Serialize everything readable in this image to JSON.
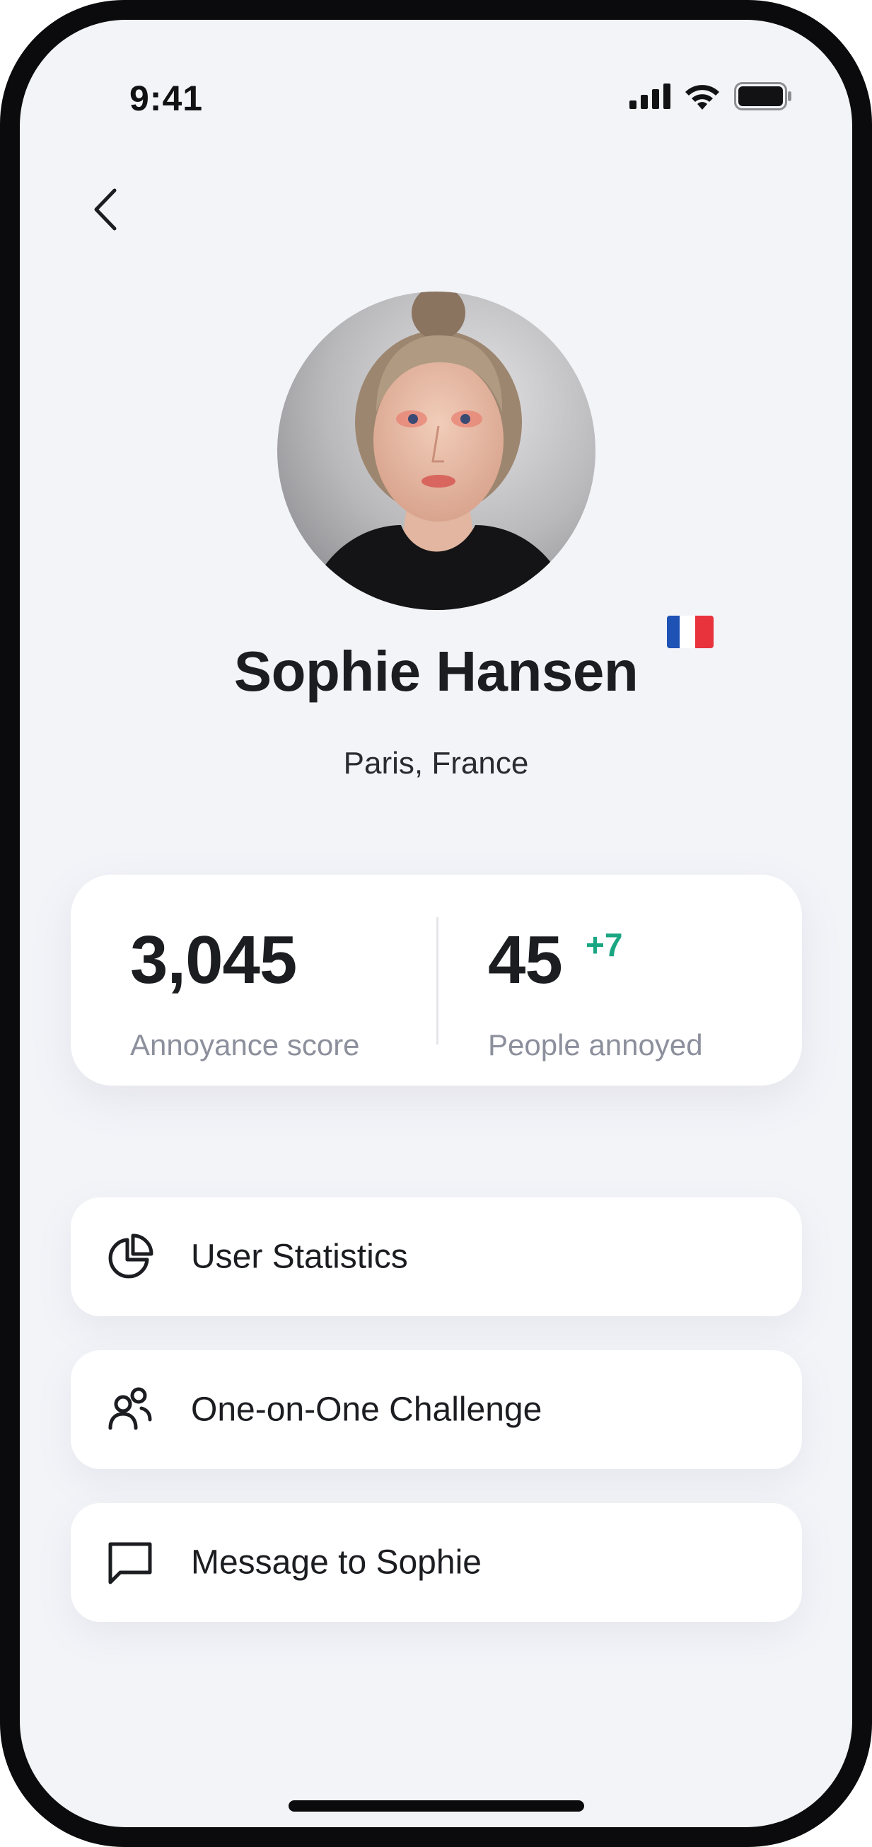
{
  "status_bar": {
    "time": "9:41",
    "signal_icon": "cellular-signal-icon",
    "wifi_icon": "wifi-icon",
    "battery_icon": "battery-icon"
  },
  "nav": {
    "back_icon": "chevron-left-icon"
  },
  "profile": {
    "name": "Sophie Hansen",
    "location": "Paris, France",
    "flag": "french-flag-icon"
  },
  "stats": {
    "annoyance_score": {
      "value": "3,045",
      "label": "Annoyance score"
    },
    "people_annoyed": {
      "value": "45",
      "delta": "+7",
      "label": "People annoyed"
    }
  },
  "actions": [
    {
      "label": "User Statistics",
      "icon": "pie-chart-icon"
    },
    {
      "label": "One-on-One Challenge",
      "icon": "users-icon"
    },
    {
      "label": "Message to Sophie",
      "icon": "message-icon"
    }
  ],
  "colors": {
    "background": "#f3f4f8",
    "card": "#ffffff",
    "text_primary": "#1c1d21",
    "text_secondary": "#8c8f9c",
    "positive": "#1aa682"
  }
}
